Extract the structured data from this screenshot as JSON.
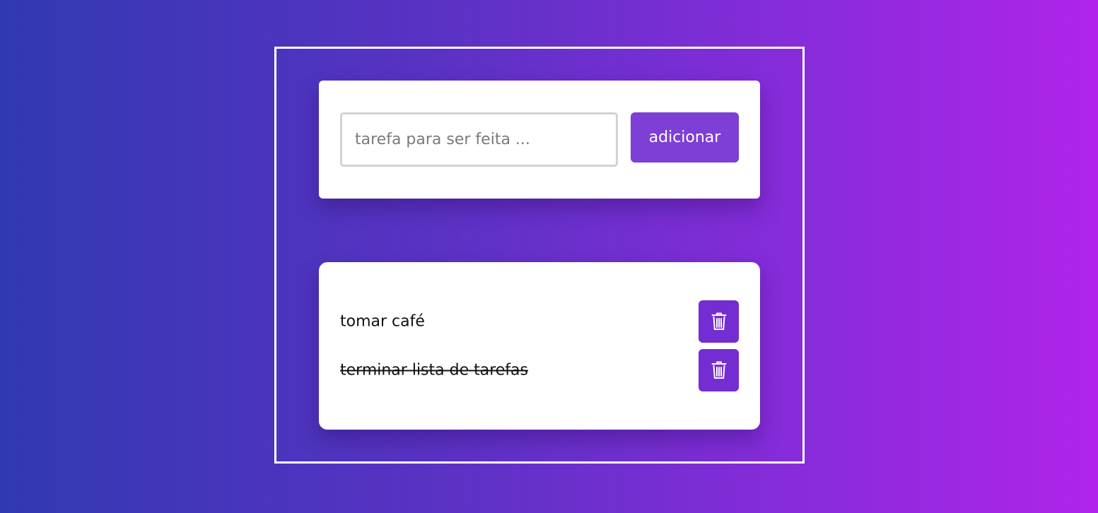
{
  "form": {
    "input_value": "",
    "input_placeholder": "tarefa para ser feita ...",
    "add_label": "adicionar"
  },
  "tasks": [
    {
      "text": "tomar café",
      "done": false,
      "delete_icon": "trash-icon"
    },
    {
      "text": "terminar lista de tarefas",
      "done": true,
      "delete_icon": "trash-icon"
    }
  ],
  "colors": {
    "background_start": "#3139b1",
    "background_end": "#b024ea",
    "accent_button": "#7d3fd6",
    "delete_button": "#742dd2",
    "card": "#ffffff"
  }
}
